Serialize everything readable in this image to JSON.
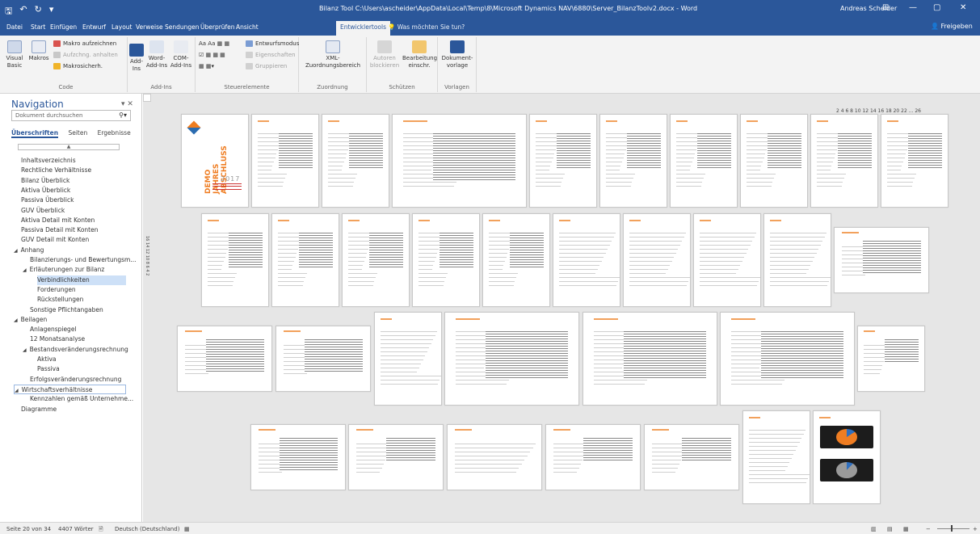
{
  "window": {
    "title": "Bilanz Tool C:\\Users\\ascheider\\AppData\\Local\\Temp\\8\\Microsoft Dynamics NAV\\6880\\Server_BilanzToolv2.docx - Word",
    "user": "Andreas Scheider",
    "controls": [
      "⊞",
      "—",
      "▢",
      "✕"
    ]
  },
  "tabs": [
    "Datei",
    "Start",
    "Einfügen",
    "Entwurf",
    "Layout",
    "Verweise",
    "Sendungen",
    "Überprüfen",
    "Ansicht",
    "Entwicklertools"
  ],
  "active_tab": "Entwicklertools",
  "tell_me": "Was möchten Sie tun?",
  "share": "Freigeben",
  "ribbon": {
    "code": {
      "label": "Code",
      "visual_basic": [
        "Visual",
        "Basic"
      ],
      "macros": "Makros",
      "record_macro": "Makro aufzeichnen",
      "pause_recording": "Aufzchng. anhalten",
      "macro_security": "Makrosicherh."
    },
    "addins": {
      "label": "Add-Ins",
      "addins": [
        "Add-",
        "Ins"
      ],
      "word_addins": [
        "Word-",
        "Add-Ins"
      ],
      "com_addins": [
        "COM-",
        "Add-Ins"
      ]
    },
    "controls": {
      "label": "Steuerelemente",
      "design_mode": "Entwurfsmodus",
      "properties": "Eigenschaften",
      "group": "Gruppieren"
    },
    "mapping": {
      "label": "Zuordnung",
      "xml": [
        "XML-",
        "Zuordnungsbereich"
      ]
    },
    "protect": {
      "label": "Schützen",
      "authors": [
        "Autoren",
        "blockieren"
      ],
      "restrict": [
        "Bearbeitung",
        "einschr."
      ]
    },
    "templates": {
      "label": "Vorlagen",
      "doc_template": [
        "Dokument-",
        "vorlage"
      ]
    }
  },
  "nav": {
    "title": "Navigation",
    "search_placeholder": "Dokument durchsuchen",
    "tabs": [
      "Überschriften",
      "Seiten",
      "Ergebnisse"
    ],
    "collapse_bar": "▲",
    "items": [
      {
        "label": "Inhaltsverzeichnis",
        "level": 0,
        "arrow": ""
      },
      {
        "label": "Rechtliche Verhältnisse",
        "level": 0,
        "arrow": ""
      },
      {
        "label": "Bilanz Überblick",
        "level": 0,
        "arrow": ""
      },
      {
        "label": "Aktiva Überblick",
        "level": 0,
        "arrow": ""
      },
      {
        "label": "Passiva Überblick",
        "level": 0,
        "arrow": ""
      },
      {
        "label": "GUV Überblick",
        "level": 0,
        "arrow": ""
      },
      {
        "label": "Aktiva Detail mit Konten",
        "level": 0,
        "arrow": ""
      },
      {
        "label": "Passiva Detail mit Konten",
        "level": 0,
        "arrow": ""
      },
      {
        "label": "GUV Detail mit Konten",
        "level": 0,
        "arrow": ""
      },
      {
        "label": "Anhang",
        "level": 0,
        "arrow": "◢"
      },
      {
        "label": "Bilanzierungs- und Bewertungsm...",
        "level": 1,
        "arrow": ""
      },
      {
        "label": "Erläuterungen zur Bilanz",
        "level": 1,
        "arrow": "◢"
      },
      {
        "label": "Verbindlichkeiten",
        "level": 2,
        "arrow": ""
      },
      {
        "label": "Forderungen",
        "level": 2,
        "arrow": ""
      },
      {
        "label": "Rückstellungen",
        "level": 2,
        "arrow": ""
      },
      {
        "label": "Sonstige Pflichtangaben",
        "level": 1,
        "arrow": ""
      },
      {
        "label": "Beilagen",
        "level": 0,
        "arrow": "◢"
      },
      {
        "label": "Anlagenspiegel",
        "level": 1,
        "arrow": ""
      },
      {
        "label": "12 Monatsanalyse",
        "level": 1,
        "arrow": ""
      },
      {
        "label": "Bestandsveränderungsrechnung",
        "level": 1,
        "arrow": "◢"
      },
      {
        "label": "Aktiva",
        "level": 2,
        "arrow": ""
      },
      {
        "label": "Passiva",
        "level": 2,
        "arrow": ""
      },
      {
        "label": "Erfolgsveränderungsrechnung",
        "level": 1,
        "arrow": ""
      },
      {
        "label": "Wirtschaftsverhältnisse",
        "level": 0,
        "arrow": "◢"
      },
      {
        "label": "Kennzahlen gemäß Unternehme...",
        "level": 1,
        "arrow": ""
      },
      {
        "label": "Diagramme",
        "level": 0,
        "arrow": ""
      }
    ],
    "selected": "Verbindlichkeiten",
    "outlined": "Wirtschaftsverhältnisse"
  },
  "document": {
    "page_numbers": "2 4 6 8 10 12 14 16 18 20 22 ... 26",
    "vertical_ruler": "16 14 12 10 8 6 4 2",
    "cover": {
      "lines": [
        "DEMO",
        "JAHRES",
        "ABSCHLUSS"
      ],
      "year": "2017"
    }
  },
  "status": {
    "page": "Seite 20 von 34",
    "words": "4407 Wörter",
    "language": "Deutsch (Deutschland)"
  },
  "colors": {
    "brand": "#2b579a",
    "accent": "#ef7d22"
  }
}
